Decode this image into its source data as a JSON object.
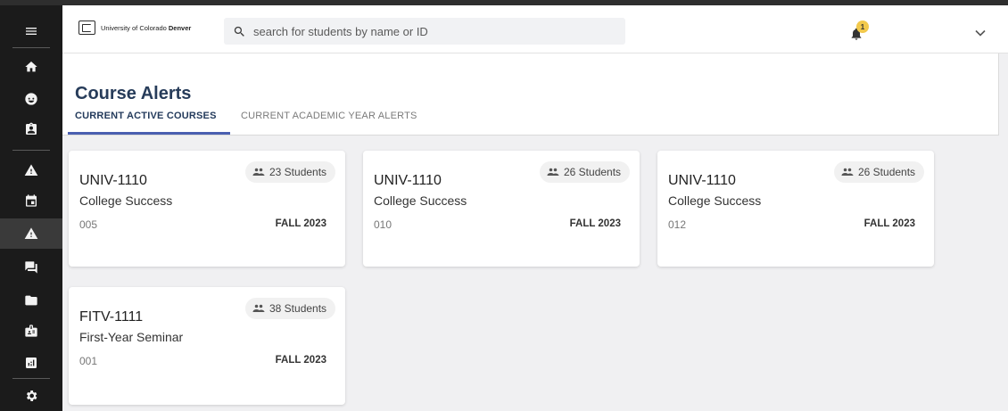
{
  "header": {
    "logo": {
      "prefix": "University of Colorado ",
      "bold": "Denver"
    },
    "search_placeholder": "search for students by name or ID",
    "notification_count": "1"
  },
  "sidebar": {
    "items": [
      {
        "icon": "menu-icon"
      },
      {
        "icon": "home-icon"
      },
      {
        "icon": "face-icon"
      },
      {
        "icon": "assignment-ind-icon"
      },
      {
        "icon": "warning-icon"
      },
      {
        "icon": "calendar-icon"
      },
      {
        "icon": "warning-icon",
        "active": true
      },
      {
        "icon": "forum-icon"
      },
      {
        "icon": "folder-icon"
      },
      {
        "icon": "badge-icon"
      },
      {
        "icon": "analytics-icon"
      },
      {
        "icon": "gear-icon"
      }
    ]
  },
  "page": {
    "title": "Course Alerts",
    "tabs": [
      {
        "label": "CURRENT ACTIVE COURSES",
        "active": true
      },
      {
        "label": "CURRENT ACADEMIC YEAR ALERTS",
        "active": false
      }
    ]
  },
  "courses": [
    {
      "code": "UNIV-1110",
      "name": "College Success",
      "section": "005",
      "term": "FALL 2023",
      "students": "23 Students"
    },
    {
      "code": "UNIV-1110",
      "name": "College Success",
      "section": "010",
      "term": "FALL 2023",
      "students": "26 Students"
    },
    {
      "code": "UNIV-1110",
      "name": "College Success",
      "section": "012",
      "term": "FALL 2023",
      "students": "26 Students"
    },
    {
      "code": "FITV-1111",
      "name": "First-Year Seminar",
      "section": "001",
      "term": "FALL 2023",
      "students": "38 Students"
    }
  ],
  "colors": {
    "accent": "#4a5fb0",
    "title": "#273c5a",
    "badge": "#f2c94c",
    "sidebar": "#1b1b1b"
  }
}
